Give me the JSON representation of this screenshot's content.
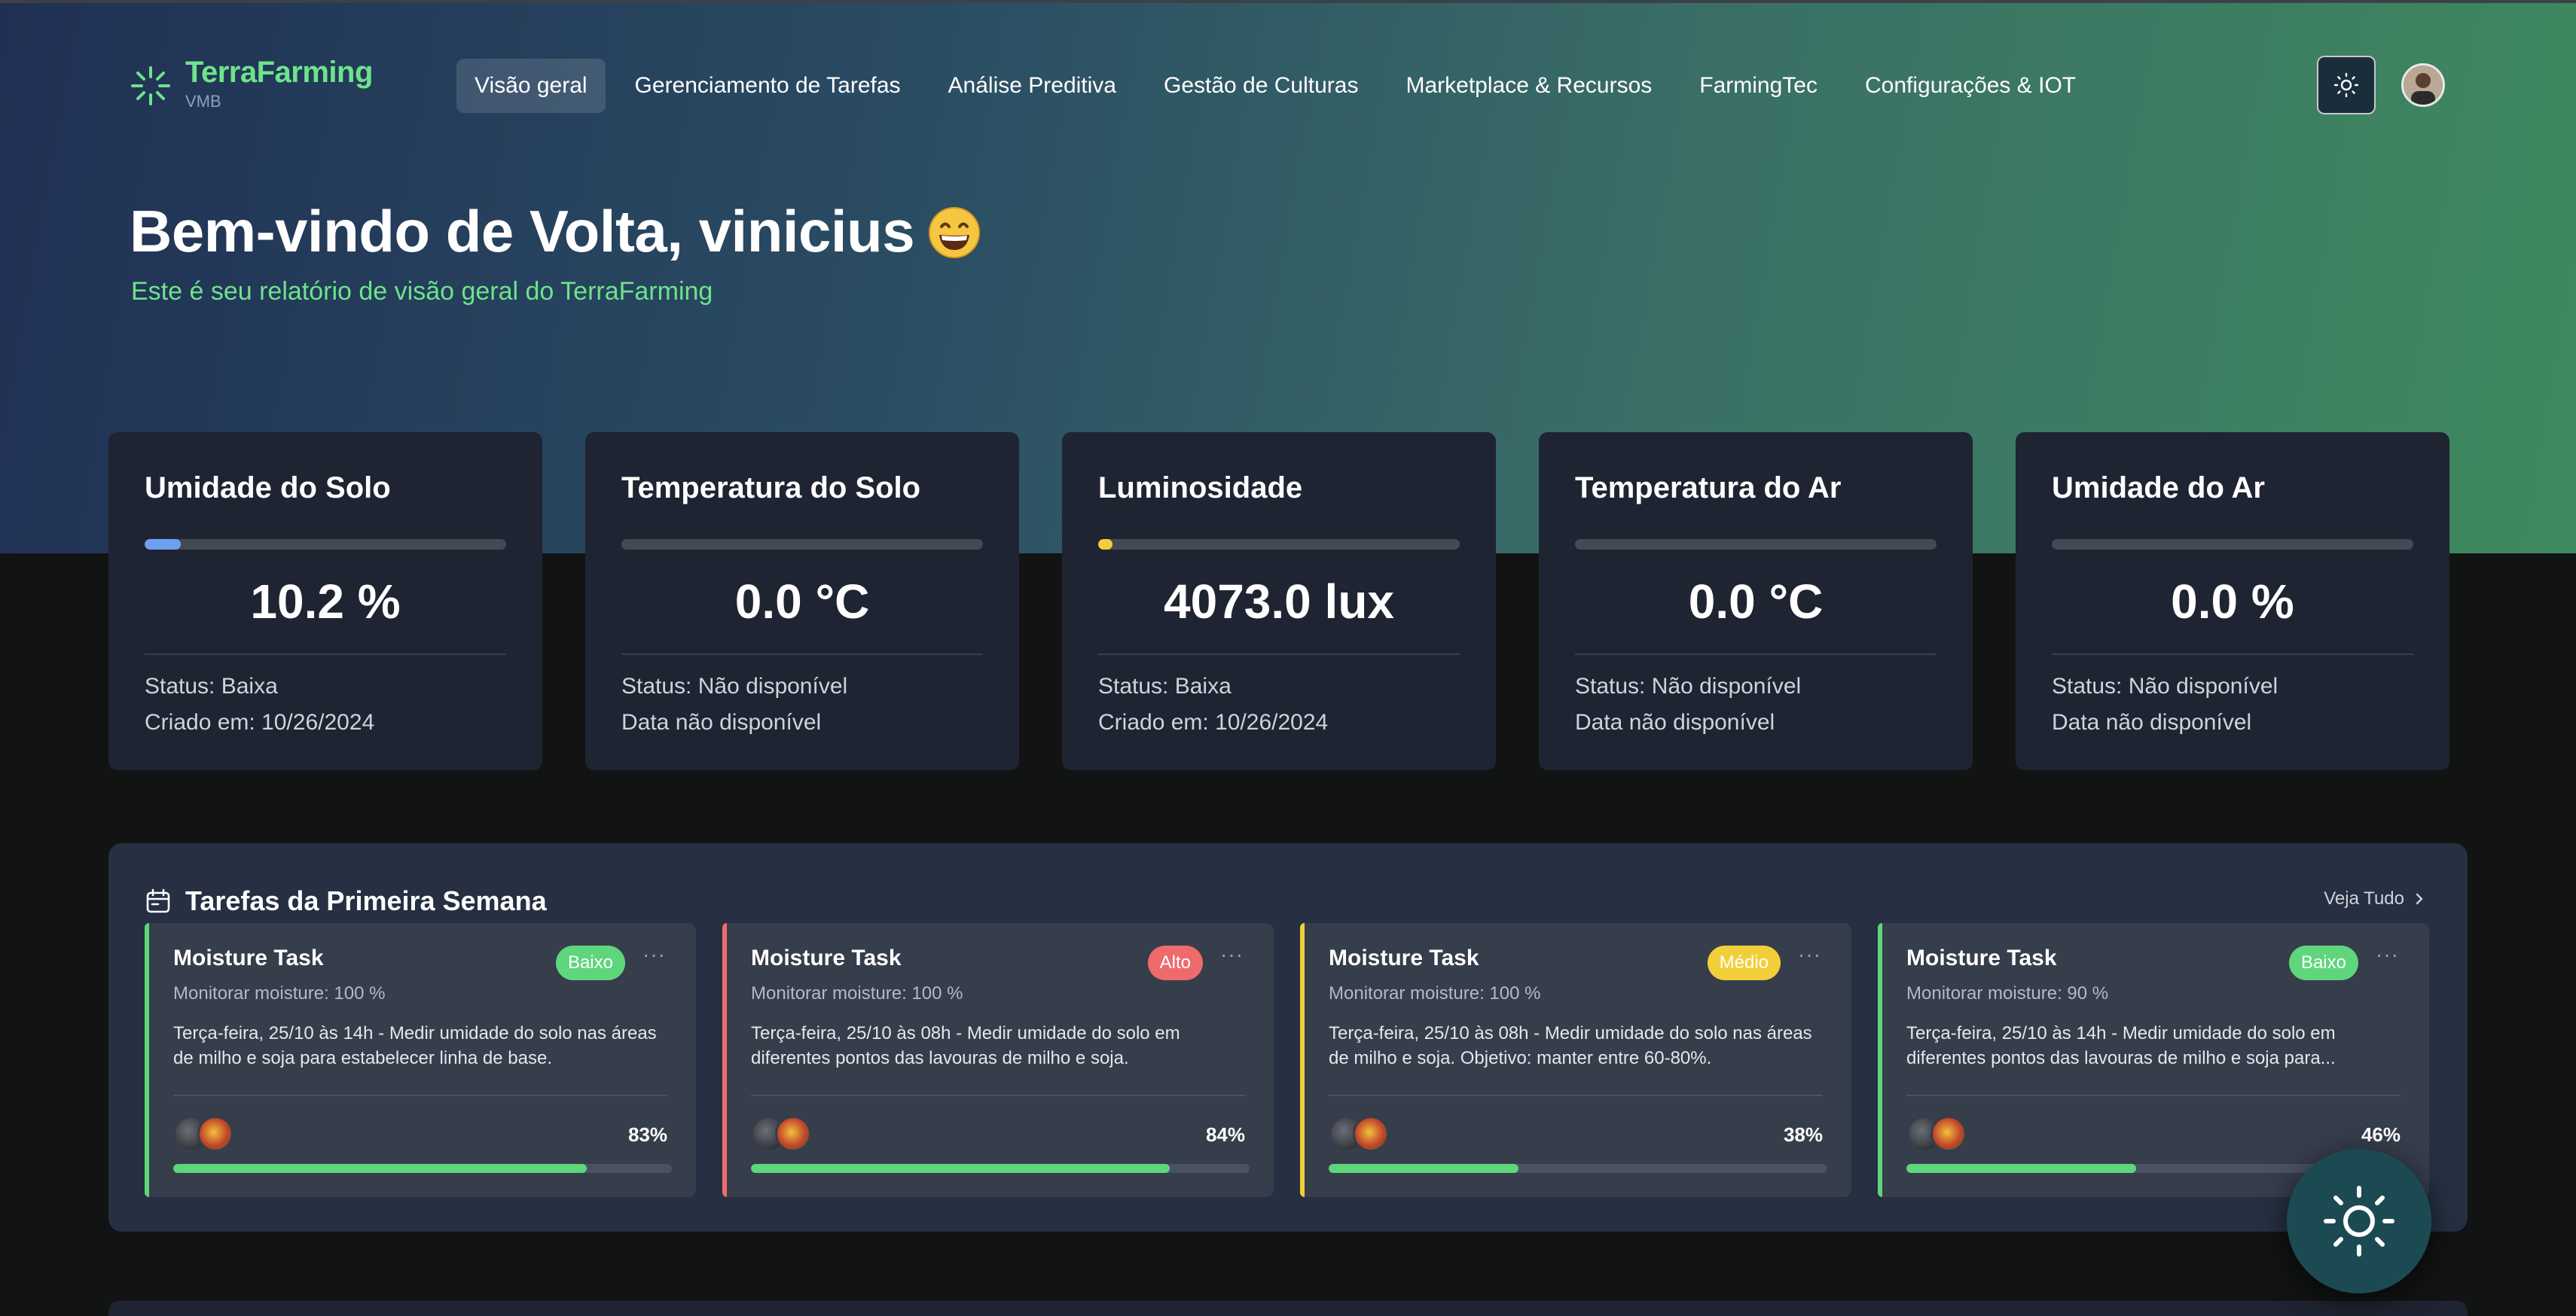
{
  "brand": {
    "name": "TerraFarming",
    "sub": "VMB",
    "accent": "#6ee38a"
  },
  "nav": {
    "items": [
      {
        "label": "Visão geral",
        "active": true
      },
      {
        "label": "Gerenciamento de Tarefas",
        "active": false
      },
      {
        "label": "Análise Preditiva",
        "active": false
      },
      {
        "label": "Gestão de Culturas",
        "active": false
      },
      {
        "label": "Marketplace & Recursos",
        "active": false
      },
      {
        "label": "FarmingTec",
        "active": false
      },
      {
        "label": "Configurações & IOT",
        "active": false
      }
    ],
    "theme_icon": "sun-icon",
    "avatar_icon": "user-avatar"
  },
  "welcome": {
    "title": "Bem-vindo de Volta, vinicius",
    "emoji": "grinning-face",
    "subtitle": "Este é seu relatório de visão geral do TerraFarming"
  },
  "metrics": [
    {
      "title": "Umidade do Solo",
      "value": "10.2 %",
      "level": 0.1,
      "bar_color": "#6ea0f0",
      "status": "Status: Baixa",
      "date": "Criado em: 10/26/2024"
    },
    {
      "title": "Temperatura do Solo",
      "value": "0.0 °C",
      "level": 0,
      "bar_color": "#6ea0f0",
      "status": "Status: Não disponível",
      "date": "Data não disponível"
    },
    {
      "title": "Luminosidade",
      "value": "4073.0 lux",
      "level": 0.04,
      "bar_color": "#f2cf3a",
      "status": "Status: Baixa",
      "date": "Criado em: 10/26/2024"
    },
    {
      "title": "Temperatura do Ar",
      "value": "0.0 °C",
      "level": 0,
      "bar_color": "#6ea0f0",
      "status": "Status: Não disponível",
      "date": "Data não disponível"
    },
    {
      "title": "Umidade do Ar",
      "value": "0.0 %",
      "level": 0,
      "bar_color": "#6ea0f0",
      "status": "Status: Não disponível",
      "date": "Data não disponível"
    }
  ],
  "tasks": {
    "title": "Tarefas da Primeira Semana",
    "icon": "calendar-icon",
    "see_all": "Veja Tudo",
    "items": [
      {
        "title": "Moisture Task",
        "badge": "Baixo",
        "badge_bg": "#5fd67c",
        "badge_fg": "#ffffff",
        "accent": "#5fd67c",
        "more": "···",
        "sub": "Monitorar moisture: 100 %",
        "desc": "Terça-feira, 25/10 às 14h - Medir umidade do solo nas áreas de milho e soja para estabelecer linha de base.",
        "percent": "83%",
        "progress": 0.83
      },
      {
        "title": "Moisture Task",
        "badge": "Alto",
        "badge_bg": "#ef6b6b",
        "badge_fg": "#ffffff",
        "accent": "#ef6b6b",
        "more": "···",
        "sub": "Monitorar moisture: 100 %",
        "desc": "Terça-feira, 25/10 às 08h - Medir umidade do solo em diferentes pontos das lavouras de milho e soja.",
        "percent": "84%",
        "progress": 0.84
      },
      {
        "title": "Moisture Task",
        "badge": "Médio",
        "badge_bg": "#f2cf3a",
        "badge_fg": "#ffffff",
        "accent": "#f2cf3a",
        "more": "···",
        "sub": "Monitorar moisture: 100 %",
        "desc": "Terça-feira, 25/10 às 08h - Medir umidade do solo nas áreas de milho e soja. Objetivo: manter entre 60-80%.",
        "percent": "38%",
        "progress": 0.38
      },
      {
        "title": "Moisture Task",
        "badge": "Baixo",
        "badge_bg": "#5fd67c",
        "badge_fg": "#ffffff",
        "accent": "#5fd67c",
        "more": "···",
        "sub": "Monitorar moisture: 90 %",
        "desc": "Terça-feira, 25/10 às 14h - Medir umidade do solo em diferentes pontos das lavouras de milho e soja para...",
        "percent": "46%",
        "progress": 0.46
      }
    ]
  },
  "fab": {
    "icon": "sun-icon"
  }
}
